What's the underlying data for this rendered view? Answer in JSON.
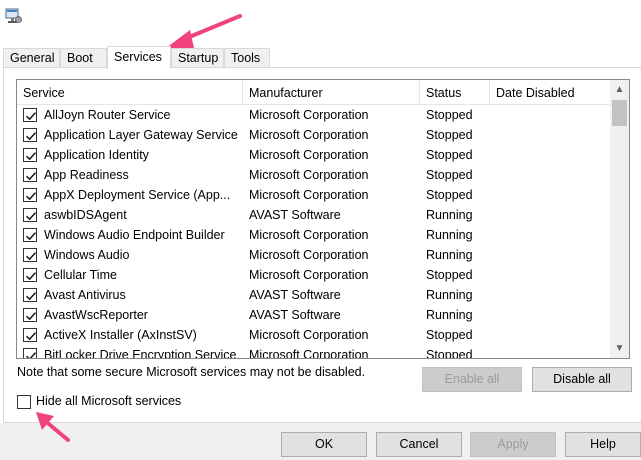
{
  "tabs": [
    "General",
    "Boot",
    "Services",
    "Startup",
    "Tools"
  ],
  "active_tab": "Services",
  "columns": {
    "service": "Service",
    "manufacturer": "Manufacturer",
    "status": "Status",
    "date_disabled": "Date Disabled"
  },
  "services": [
    {
      "name": "AllJoyn Router Service",
      "manufacturer": "Microsoft Corporation",
      "status": "Stopped",
      "date": "",
      "checked": true
    },
    {
      "name": "Application Layer Gateway Service",
      "manufacturer": "Microsoft Corporation",
      "status": "Stopped",
      "date": "",
      "checked": true
    },
    {
      "name": "Application Identity",
      "manufacturer": "Microsoft Corporation",
      "status": "Stopped",
      "date": "",
      "checked": true
    },
    {
      "name": "App Readiness",
      "manufacturer": "Microsoft Corporation",
      "status": "Stopped",
      "date": "",
      "checked": true
    },
    {
      "name": "AppX Deployment Service (App...",
      "manufacturer": "Microsoft Corporation",
      "status": "Stopped",
      "date": "",
      "checked": true
    },
    {
      "name": "aswbIDSAgent",
      "manufacturer": "AVAST Software",
      "status": "Running",
      "date": "",
      "checked": true
    },
    {
      "name": "Windows Audio Endpoint Builder",
      "manufacturer": "Microsoft Corporation",
      "status": "Running",
      "date": "",
      "checked": true
    },
    {
      "name": "Windows Audio",
      "manufacturer": "Microsoft Corporation",
      "status": "Running",
      "date": "",
      "checked": true
    },
    {
      "name": "Cellular Time",
      "manufacturer": "Microsoft Corporation",
      "status": "Stopped",
      "date": "",
      "checked": true
    },
    {
      "name": "Avast Antivirus",
      "manufacturer": "AVAST Software",
      "status": "Running",
      "date": "",
      "checked": true
    },
    {
      "name": "AvastWscReporter",
      "manufacturer": "AVAST Software",
      "status": "Running",
      "date": "",
      "checked": true
    },
    {
      "name": "ActiveX Installer (AxInstSV)",
      "manufacturer": "Microsoft Corporation",
      "status": "Stopped",
      "date": "",
      "checked": true
    },
    {
      "name": "BitLocker Drive Encryption Service",
      "manufacturer": "Microsoft Corporation",
      "status": "Stopped",
      "date": "",
      "checked": true
    }
  ],
  "note": "Note that some secure Microsoft services may not be disabled.",
  "buttons": {
    "enable_all": "Enable all",
    "disable_all": "Disable all",
    "ok": "OK",
    "cancel": "Cancel",
    "apply": "Apply",
    "help": "Help"
  },
  "hide_ms": {
    "label": "Hide all Microsoft services",
    "checked": false
  },
  "icons": {
    "app": "system-configuration-icon",
    "scroll_up": "chevron-up-icon",
    "scroll_down": "chevron-down-icon",
    "annotation": "arrow-annotation-icon"
  },
  "colors": {
    "annotation": "#f0437d"
  }
}
